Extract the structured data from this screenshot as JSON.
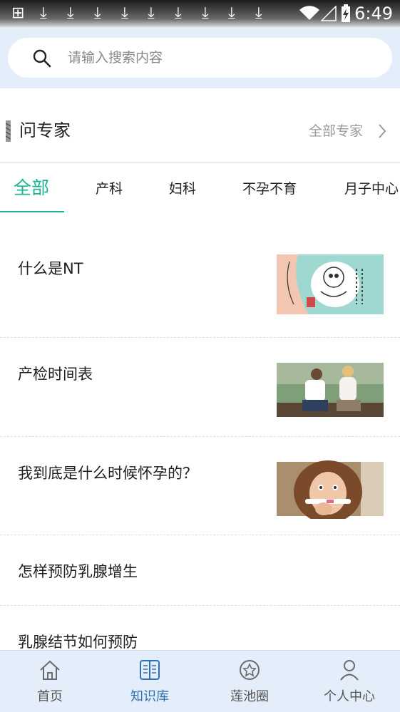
{
  "status_bar": {
    "time": "6:49"
  },
  "search": {
    "placeholder": "请输入搜索内容"
  },
  "expert_section": {
    "title": "问专家",
    "all_link": "全部专家"
  },
  "tabs": [
    {
      "label": "全部",
      "active": true
    },
    {
      "label": "产科",
      "active": false
    },
    {
      "label": "妇科",
      "active": false
    },
    {
      "label": "不孕不育",
      "active": false
    },
    {
      "label": "月子中心",
      "active": false
    }
  ],
  "articles": [
    {
      "title": "什么是NT",
      "has_image": true,
      "image": "nt-illustration"
    },
    {
      "title": "产检时间表",
      "has_image": true,
      "image": "couple-pregnancy-photo"
    },
    {
      "title": "我到底是什么时候怀孕的？",
      "has_image": true,
      "image": "woman-pregnancy-test-photo"
    },
    {
      "title": "怎样预防乳腺增生",
      "has_image": false
    },
    {
      "title": "乳腺结节如何预防",
      "has_image": false
    }
  ],
  "bottom_nav": [
    {
      "label": "首页",
      "icon": "home-icon",
      "active": false
    },
    {
      "label": "知识库",
      "icon": "book-icon",
      "active": true
    },
    {
      "label": "莲池圈",
      "icon": "community-icon",
      "active": false
    },
    {
      "label": "个人中心",
      "icon": "person-icon",
      "active": false
    }
  ],
  "colors": {
    "accent": "#1ab394",
    "nav_active": "#2f6fb3",
    "header_bg": "#e4eefa"
  }
}
